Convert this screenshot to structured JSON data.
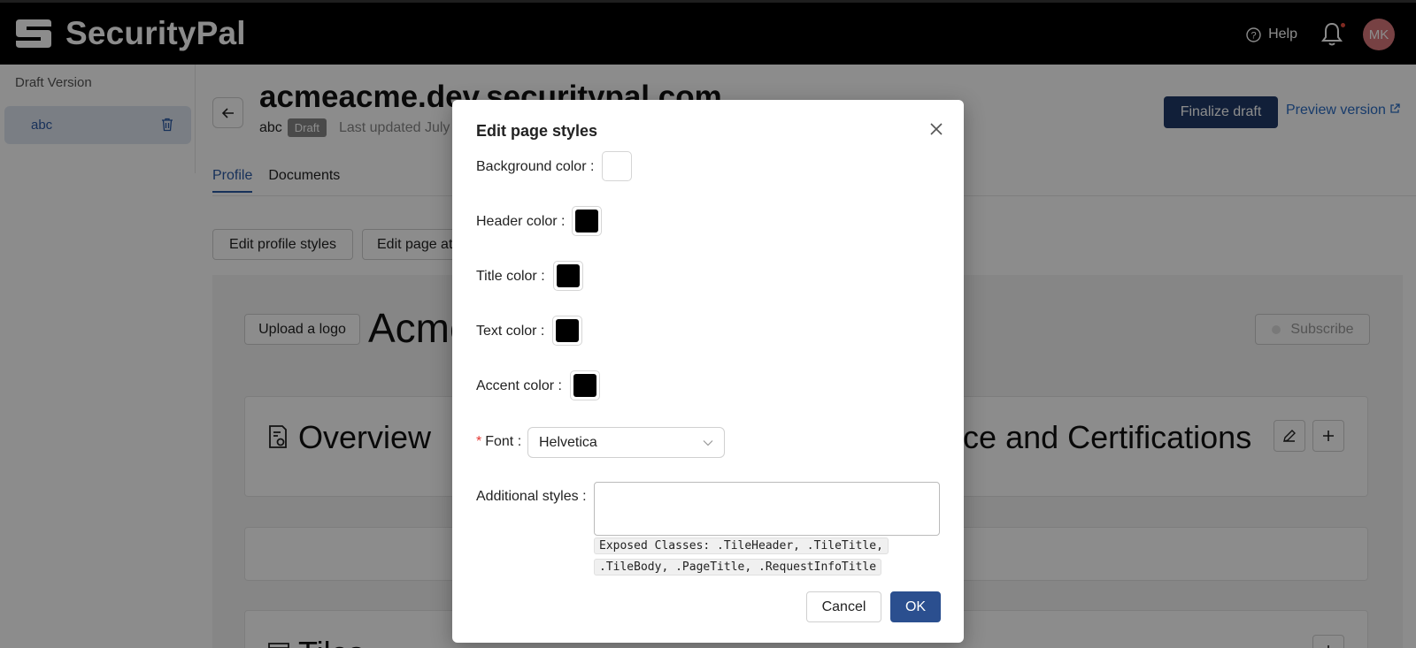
{
  "app": {
    "brand": "SecurityPal"
  },
  "header": {
    "help_label": "Help",
    "avatar_initials": "MK"
  },
  "sidebar": {
    "title": "Draft Version",
    "items": [
      {
        "label": "abc"
      }
    ]
  },
  "page": {
    "domain": "acmeacme.dev.securitypal.com",
    "version_name": "abc",
    "status_badge": "Draft",
    "last_updated": "Last updated July",
    "finalize_label": "Finalize draft",
    "preview_label": "Preview version"
  },
  "tabs": [
    {
      "label": "Profile",
      "active": true
    },
    {
      "label": "Documents",
      "active": false
    }
  ],
  "toolbar": {
    "edit_profile_styles": "Edit profile styles",
    "edit_page_attr": "Edit page at"
  },
  "profile": {
    "upload_logo": "Upload a logo",
    "company_name": "Acme",
    "subscribe": "Subscribe",
    "overview_title": "Overview",
    "compliance_title": "iance and Certifications",
    "tiles_title": "Tiles"
  },
  "modal": {
    "title": "Edit page styles",
    "background_label": "Background color",
    "header_label": "Header color",
    "title_label": "Title color",
    "text_label": "Text color",
    "accent_label": "Accent color",
    "font_label": "Font",
    "font_value": "Helvetica",
    "additional_label": "Additional styles",
    "additional_value": "",
    "hint_line1": "Exposed Classes: .TileHeader, .TileTitle,",
    "hint_line2": ".TileBody, .PageTitle, .RequestInfoTitle",
    "cancel_label": "Cancel",
    "ok_label": "OK",
    "colors": {
      "background": "#ffffff",
      "header": "#000000",
      "title": "#000000",
      "text": "#000000",
      "accent": "#000000"
    }
  },
  "theme": {
    "primary": "#1f3a68",
    "link": "#2b6cc4",
    "danger": "#e53935"
  }
}
